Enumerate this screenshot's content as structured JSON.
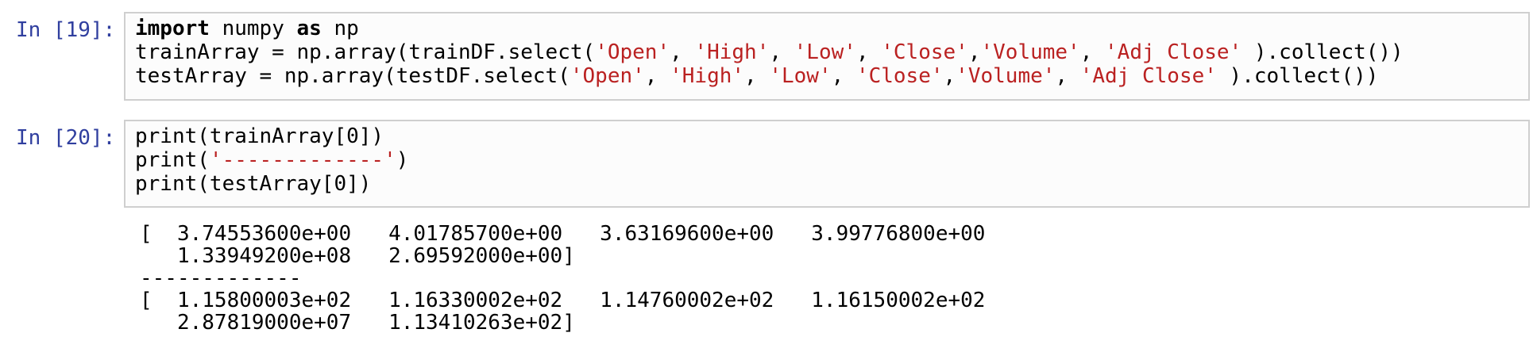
{
  "cells": [
    {
      "prompt": "In [19]:",
      "lines": [
        [
          {
            "t": "import",
            "c": "kw"
          },
          {
            "t": " numpy ",
            "c": ""
          },
          {
            "t": "as",
            "c": "kw"
          },
          {
            "t": " np",
            "c": ""
          }
        ],
        [
          {
            "t": "trainArray = np.array(trainDF.select(",
            "c": ""
          },
          {
            "t": "'Open'",
            "c": "str"
          },
          {
            "t": ", ",
            "c": ""
          },
          {
            "t": "'High'",
            "c": "str"
          },
          {
            "t": ", ",
            "c": ""
          },
          {
            "t": "'Low'",
            "c": "str"
          },
          {
            "t": ", ",
            "c": ""
          },
          {
            "t": "'Close'",
            "c": "str"
          },
          {
            "t": ",",
            "c": ""
          },
          {
            "t": "'Volume'",
            "c": "str"
          },
          {
            "t": ", ",
            "c": ""
          },
          {
            "t": "'Adj Close'",
            "c": "str"
          },
          {
            "t": " ).collect())",
            "c": ""
          }
        ],
        [
          {
            "t": "testArray = np.array(testDF.select(",
            "c": ""
          },
          {
            "t": "'Open'",
            "c": "str"
          },
          {
            "t": ", ",
            "c": ""
          },
          {
            "t": "'High'",
            "c": "str"
          },
          {
            "t": ", ",
            "c": ""
          },
          {
            "t": "'Low'",
            "c": "str"
          },
          {
            "t": ", ",
            "c": ""
          },
          {
            "t": "'Close'",
            "c": "str"
          },
          {
            "t": ",",
            "c": ""
          },
          {
            "t": "'Volume'",
            "c": "str"
          },
          {
            "t": ", ",
            "c": ""
          },
          {
            "t": "'Adj Close'",
            "c": "str"
          },
          {
            "t": " ).collect())",
            "c": ""
          }
        ]
      ]
    },
    {
      "prompt": "In [20]:",
      "lines": [
        [
          {
            "t": "print(trainArray[0])",
            "c": ""
          }
        ],
        [
          {
            "t": "print(",
            "c": ""
          },
          {
            "t": "'-------------'",
            "c": "str"
          },
          {
            "t": ")",
            "c": ""
          }
        ],
        [
          {
            "t": "print(testArray[0])",
            "c": ""
          }
        ]
      ],
      "output": "[  3.74553600e+00   4.01785700e+00   3.63169600e+00   3.99776800e+00\n   1.33949200e+08   2.69592000e+00]\n-------------\n[  1.15800003e+02   1.16330002e+02   1.14760002e+02   1.16150002e+02\n   2.87819000e+07   1.13410263e+02]"
    }
  ]
}
